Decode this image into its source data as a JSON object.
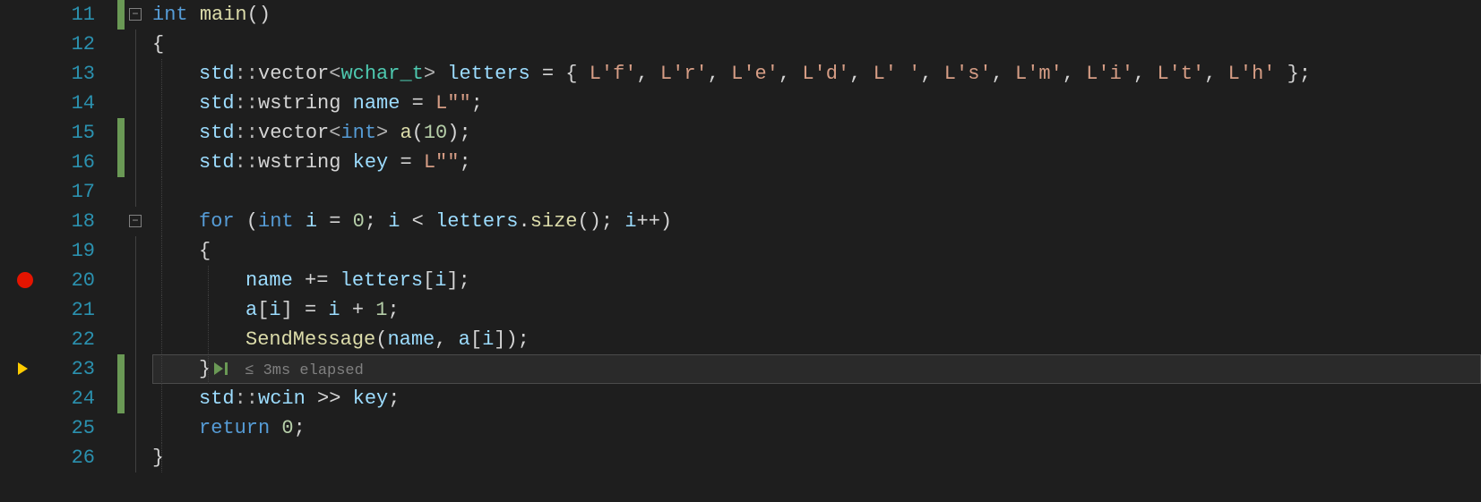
{
  "first_line_no": 11,
  "breakpoint_line": 20,
  "current_line": 23,
  "current_hint": "≤ 3ms elapsed",
  "modified_lines": [
    11,
    15,
    16,
    23,
    24
  ],
  "fold_lines": {
    "11": "-",
    "18": "-"
  },
  "lines": [
    {
      "n": 11,
      "tokens": [
        [
          "kw",
          "int"
        ],
        [
          "pun",
          " "
        ],
        [
          "fn",
          "main"
        ],
        [
          "pun",
          "()"
        ]
      ],
      "indent": 0,
      "guides": []
    },
    {
      "n": 12,
      "tokens": [
        [
          "pun",
          "{"
        ]
      ],
      "indent": 0,
      "guides": []
    },
    {
      "n": 13,
      "tokens": [
        [
          "var",
          "std"
        ],
        [
          "op",
          "::"
        ],
        [
          "txt",
          "vector"
        ],
        [
          "op",
          "<"
        ],
        [
          "typ",
          "wchar_t"
        ],
        [
          "op",
          ">"
        ],
        [
          "pun",
          " "
        ],
        [
          "var",
          "letters"
        ],
        [
          "pun",
          " = { "
        ],
        [
          "str",
          "L'f'"
        ],
        [
          "pun",
          ", "
        ],
        [
          "str",
          "L'r'"
        ],
        [
          "pun",
          ", "
        ],
        [
          "str",
          "L'e'"
        ],
        [
          "pun",
          ", "
        ],
        [
          "str",
          "L'd'"
        ],
        [
          "pun",
          ", "
        ],
        [
          "str",
          "L' '"
        ],
        [
          "pun",
          ", "
        ],
        [
          "str",
          "L's'"
        ],
        [
          "pun",
          ", "
        ],
        [
          "str",
          "L'm'"
        ],
        [
          "pun",
          ", "
        ],
        [
          "str",
          "L'i'"
        ],
        [
          "pun",
          ", "
        ],
        [
          "str",
          "L't'"
        ],
        [
          "pun",
          ", "
        ],
        [
          "str",
          "L'h'"
        ],
        [
          "pun",
          " };"
        ]
      ],
      "indent": 1,
      "guides": [
        1
      ]
    },
    {
      "n": 14,
      "tokens": [
        [
          "var",
          "std"
        ],
        [
          "op",
          "::"
        ],
        [
          "txt",
          "wstring "
        ],
        [
          "var",
          "name"
        ],
        [
          "pun",
          " = "
        ],
        [
          "str",
          "L\"\""
        ],
        [
          "pun",
          ";"
        ]
      ],
      "indent": 1,
      "guides": [
        1
      ]
    },
    {
      "n": 15,
      "tokens": [
        [
          "var",
          "std"
        ],
        [
          "op",
          "::"
        ],
        [
          "txt",
          "vector"
        ],
        [
          "op",
          "<"
        ],
        [
          "kw",
          "int"
        ],
        [
          "op",
          ">"
        ],
        [
          "pun",
          " "
        ],
        [
          "fn",
          "a"
        ],
        [
          "pun",
          "("
        ],
        [
          "num",
          "10"
        ],
        [
          "pun",
          ");"
        ]
      ],
      "indent": 1,
      "guides": [
        1
      ]
    },
    {
      "n": 16,
      "tokens": [
        [
          "var",
          "std"
        ],
        [
          "op",
          "::"
        ],
        [
          "txt",
          "wstring "
        ],
        [
          "var",
          "key"
        ],
        [
          "pun",
          " = "
        ],
        [
          "str",
          "L\"\""
        ],
        [
          "pun",
          ";"
        ]
      ],
      "indent": 1,
      "guides": [
        1
      ]
    },
    {
      "n": 17,
      "tokens": [],
      "indent": 0,
      "guides": [
        1
      ]
    },
    {
      "n": 18,
      "tokens": [
        [
          "kw",
          "for"
        ],
        [
          "pun",
          " ("
        ],
        [
          "kw",
          "int"
        ],
        [
          "pun",
          " "
        ],
        [
          "var",
          "i"
        ],
        [
          "pun",
          " = "
        ],
        [
          "num",
          "0"
        ],
        [
          "pun",
          "; "
        ],
        [
          "var",
          "i"
        ],
        [
          "pun",
          " < "
        ],
        [
          "var",
          "letters"
        ],
        [
          "pun",
          "."
        ],
        [
          "fn",
          "size"
        ],
        [
          "pun",
          "(); "
        ],
        [
          "var",
          "i"
        ],
        [
          "pun",
          "++)"
        ]
      ],
      "indent": 1,
      "guides": [
        1
      ]
    },
    {
      "n": 19,
      "tokens": [
        [
          "pun",
          "{"
        ]
      ],
      "indent": 1,
      "guides": [
        1
      ]
    },
    {
      "n": 20,
      "tokens": [
        [
          "var",
          "name"
        ],
        [
          "pun",
          " += "
        ],
        [
          "var",
          "letters"
        ],
        [
          "pun",
          "["
        ],
        [
          "var",
          "i"
        ],
        [
          "pun",
          "];"
        ]
      ],
      "indent": 2,
      "guides": [
        1,
        2
      ]
    },
    {
      "n": 21,
      "tokens": [
        [
          "var",
          "a"
        ],
        [
          "pun",
          "["
        ],
        [
          "var",
          "i"
        ],
        [
          "pun",
          "] = "
        ],
        [
          "var",
          "i"
        ],
        [
          "pun",
          " + "
        ],
        [
          "num",
          "1"
        ],
        [
          "pun",
          ";"
        ]
      ],
      "indent": 2,
      "guides": [
        1,
        2
      ]
    },
    {
      "n": 22,
      "tokens": [
        [
          "fn",
          "SendMessage"
        ],
        [
          "pun",
          "("
        ],
        [
          "var",
          "name"
        ],
        [
          "pun",
          ", "
        ],
        [
          "var",
          "a"
        ],
        [
          "pun",
          "["
        ],
        [
          "var",
          "i"
        ],
        [
          "pun",
          "]);"
        ]
      ],
      "indent": 2,
      "guides": [
        1,
        2
      ]
    },
    {
      "n": 23,
      "tokens": [
        [
          "pun",
          "}"
        ]
      ],
      "indent": 1,
      "guides": [
        1,
        2
      ],
      "runto": true
    },
    {
      "n": 24,
      "tokens": [
        [
          "var",
          "std"
        ],
        [
          "op",
          "::"
        ],
        [
          "var",
          "wcin"
        ],
        [
          "pun",
          " >> "
        ],
        [
          "var",
          "key"
        ],
        [
          "pun",
          ";"
        ]
      ],
      "indent": 1,
      "guides": [
        1
      ]
    },
    {
      "n": 25,
      "tokens": [
        [
          "kw",
          "return"
        ],
        [
          "pun",
          " "
        ],
        [
          "num",
          "0"
        ],
        [
          "pun",
          ";"
        ]
      ],
      "indent": 1,
      "guides": [
        1
      ]
    },
    {
      "n": 26,
      "tokens": [
        [
          "pun",
          "}"
        ]
      ],
      "indent": 0,
      "guides": [
        1
      ]
    }
  ]
}
